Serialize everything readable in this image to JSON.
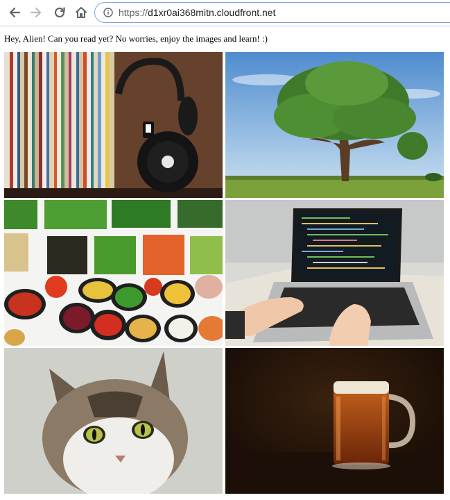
{
  "browser": {
    "url_scheme": "https://",
    "url_host": "d1xr0ai368mitn.cloudfront.net",
    "icons": {
      "back": "back-arrow-icon",
      "forward": "forward-arrow-icon",
      "reload": "reload-icon",
      "home": "home-icon",
      "security": "info-icon"
    }
  },
  "page": {
    "greeting": "Hey, Alien! Can you read yet? No worries, enjoy the images and learn! :)"
  },
  "images": [
    {
      "subject": "vinyl records and headphones"
    },
    {
      "subject": "tree in a grassy field"
    },
    {
      "subject": "bowls of vegetables"
    },
    {
      "subject": "hands typing on a laptop with code"
    },
    {
      "subject": "tabby cat"
    },
    {
      "subject": "mug of beer"
    }
  ],
  "colors": {
    "omnibox_border": "#7aa7e6",
    "toolbar_icon": "#5f6368",
    "forward_disabled": "#b8babd",
    "divider": "#d0d0d0"
  }
}
